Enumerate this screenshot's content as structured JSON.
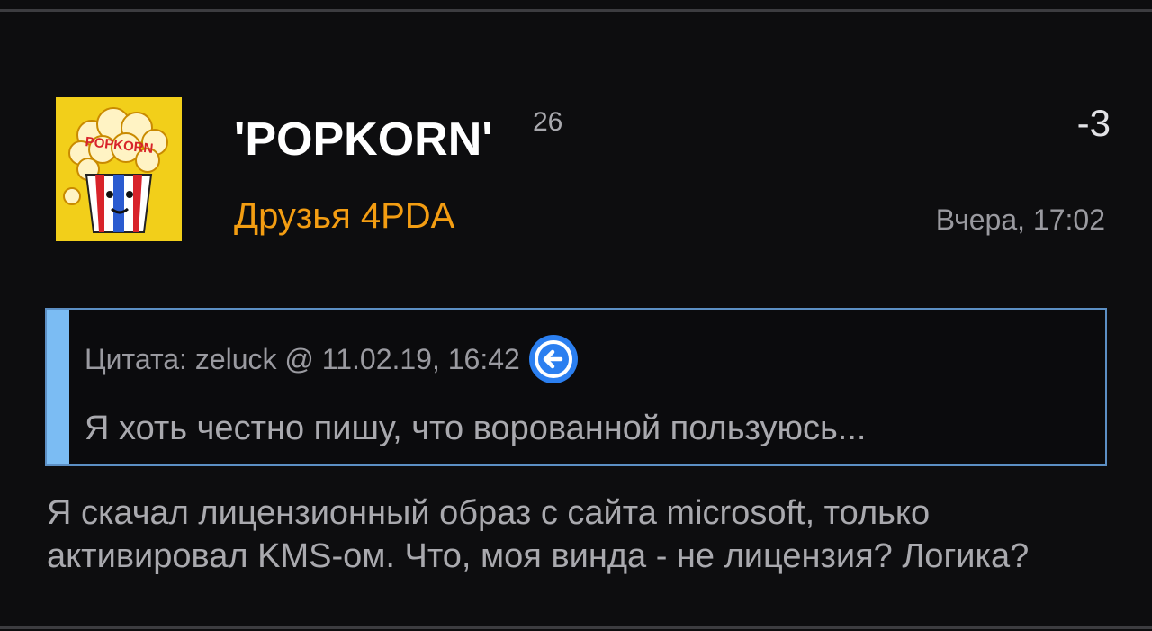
{
  "post": {
    "username": "'POPKORN'",
    "reputation": "26",
    "group": "Друзья 4PDA",
    "karma": "-3",
    "date": "Вчера, 17:02",
    "avatar_text": "POPKORN",
    "quote": {
      "header": "Цитата: zeluck @ 11.02.19, 16:42",
      "text": "Я хоть честно пишу, что ворованной пользуюсь...",
      "back_icon": "arrow-left-circle-icon"
    },
    "body": "Я скачал лицензионный образ с сайта microsoft, только активировал KMS-ом. Что, моя винда - не лицензия? Логика?"
  },
  "colors": {
    "background": "#0d0d0f",
    "username": "#ffffff",
    "group": "#f39d12",
    "quote_border": "#5c8fc4",
    "quote_bar": "#7bbcf3",
    "back_icon": "#2b7ff0",
    "muted_text": "#a9a9ae"
  }
}
